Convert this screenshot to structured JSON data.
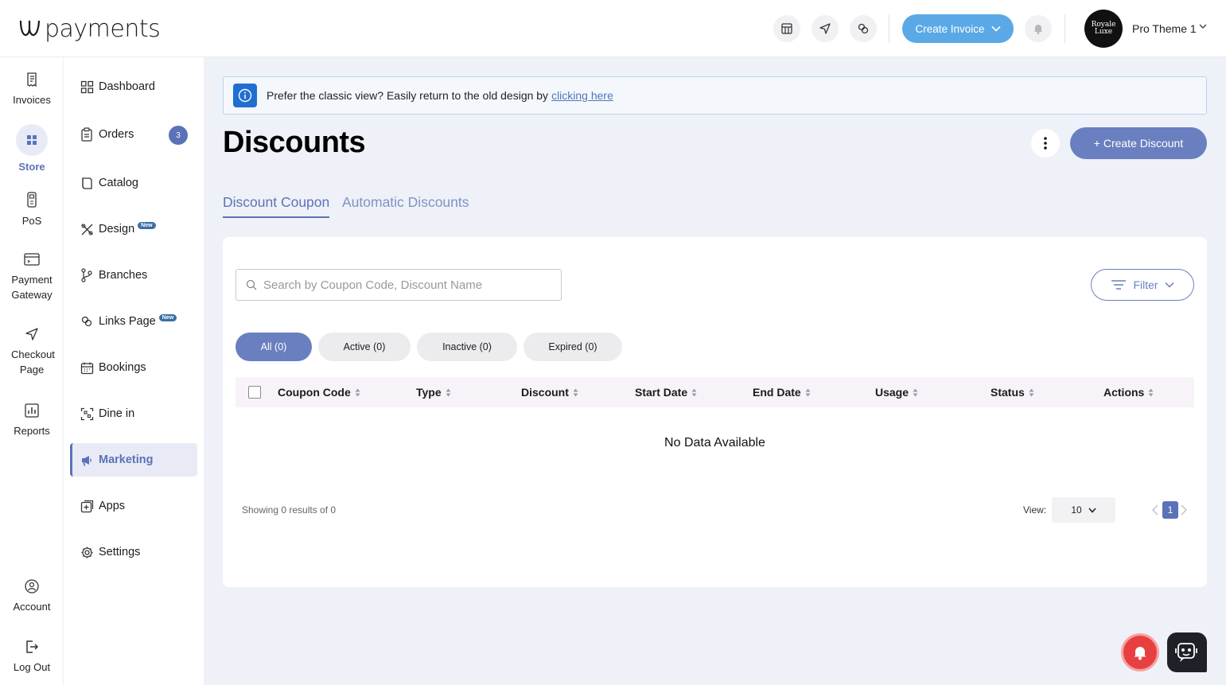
{
  "brand": {
    "name": "payments"
  },
  "topbar": {
    "create_invoice": "Create Invoice",
    "avatar_line1": "Royale",
    "avatar_line2": "Luxe",
    "profile_name": "Pro Theme 1"
  },
  "rail": [
    {
      "label": "Invoices",
      "icon": "invoice-icon"
    },
    {
      "label": "Store",
      "icon": "store-icon",
      "active": true
    },
    {
      "label": "PoS",
      "icon": "pos-icon"
    },
    {
      "label": "Payment Gateway",
      "icon": "payment-gateway-icon"
    },
    {
      "label": "Checkout Page",
      "icon": "send-icon"
    },
    {
      "label": "Reports",
      "icon": "reports-icon"
    },
    {
      "label": "Account",
      "icon": "account-icon"
    },
    {
      "label": "Log Out",
      "icon": "logout-icon"
    }
  ],
  "sidebar": {
    "items": [
      {
        "label": "Dashboard"
      },
      {
        "label": "Orders",
        "badge": "3"
      },
      {
        "label": "Catalog"
      },
      {
        "label": "Design",
        "tag": "New"
      },
      {
        "label": "Branches"
      },
      {
        "label": "Links Page",
        "tag": "New"
      },
      {
        "label": "Bookings"
      },
      {
        "label": "Dine in"
      },
      {
        "label": "Marketing",
        "active": true
      },
      {
        "label": "Apps"
      },
      {
        "label": "Settings"
      }
    ]
  },
  "notice": {
    "text": "Prefer the classic view? Easily return to the old design by",
    "link": "clicking here"
  },
  "page": {
    "title": "Discounts",
    "create_button": "+ Create Discount",
    "tabs": [
      "Discount Coupon",
      "Automatic Discounts"
    ]
  },
  "search": {
    "placeholder": "Search by Coupon Code, Discount Name"
  },
  "filter": {
    "label": "Filter"
  },
  "status_pills": [
    "All (0)",
    "Active (0)",
    "Inactive (0)",
    "Expired (0)"
  ],
  "table": {
    "columns": [
      "Coupon Code",
      "Type",
      "Discount",
      "Start Date",
      "End Date",
      "Usage",
      "Status",
      "Actions"
    ],
    "empty_text": "No Data Available"
  },
  "footer": {
    "showing": "Showing 0 results of 0",
    "view_label": "View:",
    "view_value": "10",
    "current_page": "1"
  },
  "colors": {
    "accent": "#5b72b8",
    "button": "#6a7fbf",
    "invoice_button": "#5aa9e6",
    "background": "#eff1f8"
  }
}
